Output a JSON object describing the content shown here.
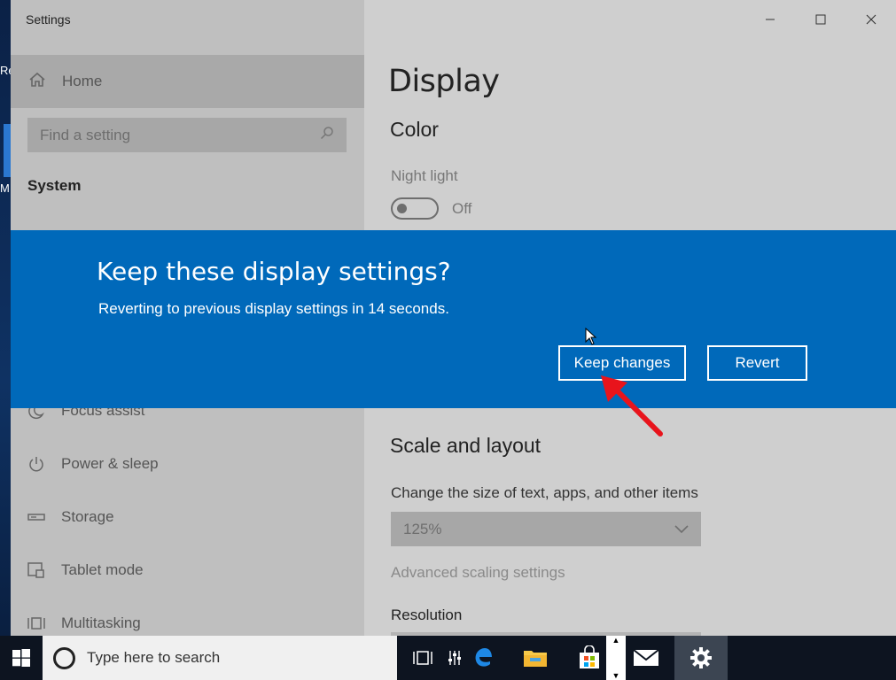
{
  "window": {
    "app_title": "Settings",
    "controls": {
      "minimize": "—",
      "maximize": "☐",
      "close": "✕"
    }
  },
  "desktop_fragments": {
    "top": "Re",
    "mid": "M"
  },
  "sidebar": {
    "home_label": "Home",
    "search_placeholder": "Find a setting",
    "section_label": "System",
    "items": [
      {
        "label": "Focus assist",
        "icon": "moon-icon"
      },
      {
        "label": "Power & sleep",
        "icon": "power-icon"
      },
      {
        "label": "Storage",
        "icon": "storage-icon"
      },
      {
        "label": "Tablet mode",
        "icon": "tablet-icon"
      },
      {
        "label": "Multitasking",
        "icon": "multitasking-icon"
      }
    ]
  },
  "main": {
    "page_title": "Display",
    "color_section": "Color",
    "night_light_label": "Night light",
    "night_light_state": "Off",
    "scale_section": "Scale and layout",
    "change_size_label": "Change the size of text, apps, and other items",
    "scale_value": "125%",
    "advanced_scaling_link": "Advanced scaling settings",
    "resolution_label": "Resolution"
  },
  "dialog": {
    "title": "Keep these display settings?",
    "message": "Reverting to previous display settings in 14 seconds.",
    "keep_label": "Keep changes",
    "revert_label": "Revert"
  },
  "taskbar": {
    "search_placeholder": "Type here to search"
  },
  "colors": {
    "dialog_bg": "#0069ba",
    "annotation_arrow": "#e8141c",
    "taskbar_bg": "#0d1420"
  }
}
